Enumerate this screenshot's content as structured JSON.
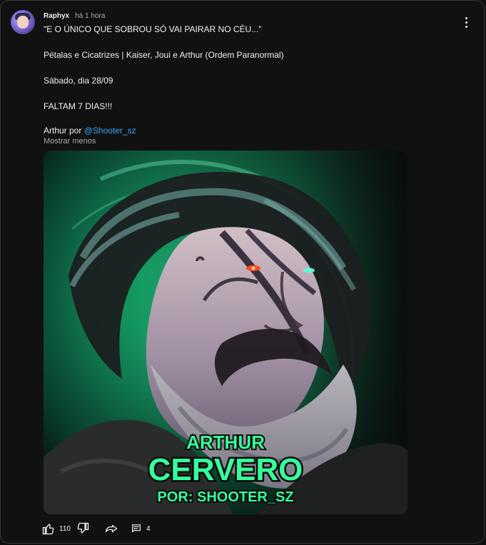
{
  "post": {
    "author": "Raphyx",
    "time": "há 1 hora",
    "text": {
      "line1": "\"E O ÚNICO QUE SOBROU SÓ VAI PAIRAR NO CÉU...\"",
      "line2": "Pétalas e Cicatrizes | Kaiser, Joui e Arthur (Ordem Paranormal)",
      "line3": "Sábado, dia 28/09",
      "line4": "FALTAM 7 DIAS!!!",
      "credit_prefix": "Arthur por ",
      "credit_link": "@Shooter_sz"
    },
    "show_less": "Mostrar menos",
    "image": {
      "title_top": "ARTHUR",
      "title_main": "CERVERO",
      "title_sub": "POR: SHOOTER_SZ"
    },
    "actions": {
      "likes": "110",
      "comments": "4"
    },
    "colors": {
      "accent_link": "#3ea6ff",
      "neon_green": "#34ff9a",
      "text_primary": "#f1f1f1",
      "text_secondary": "#aaaaaa"
    },
    "icons": {
      "menu": "more-vert-icon",
      "like": "thumb-up-icon",
      "dislike": "thumb-down-icon",
      "share": "share-icon",
      "comment": "comment-icon"
    }
  }
}
